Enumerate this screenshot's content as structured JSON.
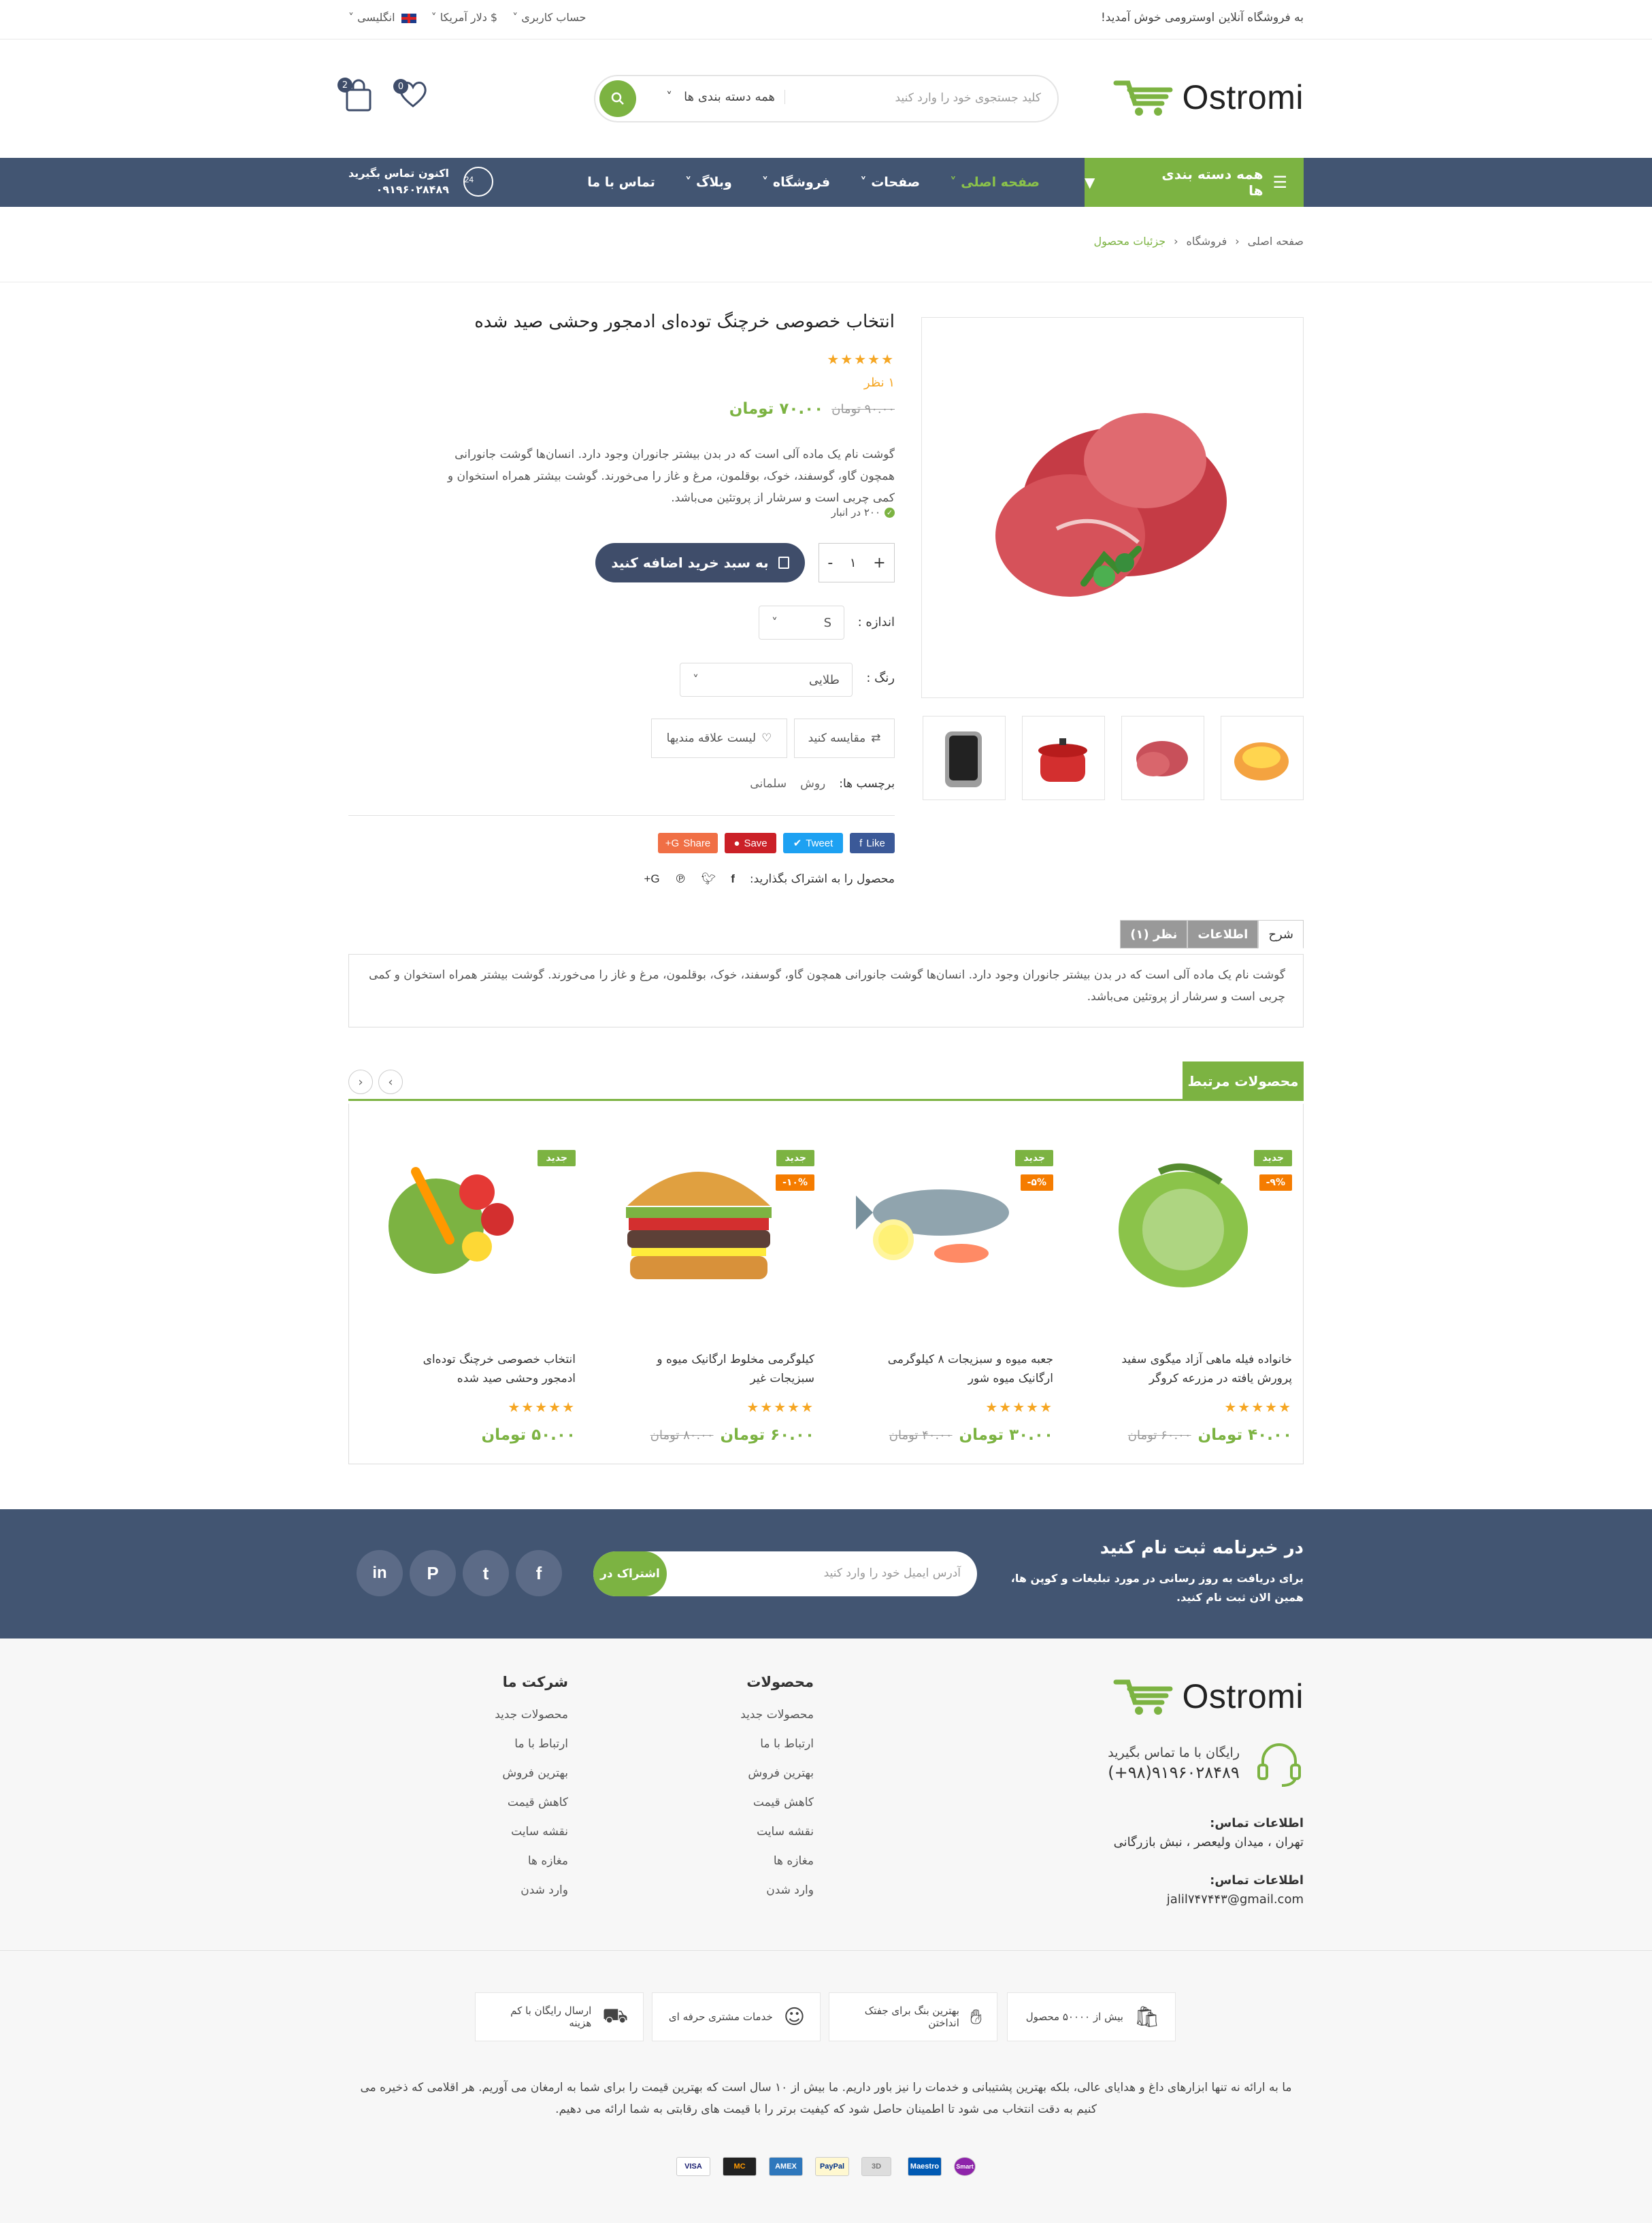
{
  "topbar": {
    "welcome": "به فروشگاه آنلاین اوسترومی خوش آمدید!",
    "account": "حساب کاربری",
    "currency": "$ دلار آمریکا",
    "language": "انگلیسی"
  },
  "brand": {
    "name": "Ostromi",
    "accent": "#7cb342",
    "nav_bg": "#425572"
  },
  "search": {
    "placeholder": "کلید جستجوی خود را وارد کنید",
    "category": "همه دسته بندی ها"
  },
  "header": {
    "wishlist_count": "0",
    "cart_count": "2"
  },
  "nav": {
    "all_categories": "همه دسته بندی ها",
    "items": [
      "صفحه اصلی",
      "صفحات",
      "فروشگاه",
      "وبلاگ",
      "تماس با ما"
    ],
    "call_label": "اکنون تماس بگیرید",
    "call_number": "۰۹۱۹۶۰۲۸۴۸۹",
    "call_badge": "24"
  },
  "breadcrumb": [
    "صفحه اصلی",
    "فروشگاه",
    "جزئیات محصول"
  ],
  "product": {
    "title": "انتخاب خصوصی خرچنگ توده‌ای ادمجور وحشی صید شده",
    "stars": "★★★★★",
    "reviews": "۱ نظر",
    "price_old": "۹۰.۰۰ تومان",
    "price_new": "۷۰.۰۰ تومان",
    "description": "گوشت نام یک ماده آلی است که در بدن بیشتر جانوران وجود دارد. انسان‌ها گوشت جانورانی همچون گاو، گوسفند، خوک، بوقلمون، مرغ و غاز را می‌خورند. گوشت بیشتر همراه استخوان و کمی چربی است و سرشار از پروتئین می‌باشد.",
    "stock": "۲۰۰ در انبار",
    "qty": "۱",
    "add_to_cart": "به سبد خرید اضافه کنید",
    "size_label": "اندازه :",
    "size_value": "S",
    "color_label": "رنگ :",
    "color_value": "طلایی",
    "compare": "مقایسه کنید",
    "wishlist": "لیست علاقه مندیها",
    "tags_label": "برچسب ها:",
    "tags": [
      "روش",
      "سلمانی"
    ],
    "share_buttons": [
      "Like",
      "Tweet",
      "Save",
      "Share"
    ],
    "share_label": "محصول را به اشتراک بگذارید:"
  },
  "tabs": {
    "items": [
      "شرح",
      "اطلاعات",
      "نظر (۱)"
    ],
    "content": "گوشت نام یک ماده آلی است که در بدن بیشتر جانوران وجود دارد. انسان‌ها گوشت جانورانی همچون گاو، گوسفند، خوک، بوقلمون، مرغ و غاز را می‌خورند. گوشت بیشتر همراه استخوان و کمی چربی است و سرشار از پروتئین می‌باشد."
  },
  "related": {
    "title": "محصولات مرتبط",
    "new_label": "جدید",
    "products": [
      {
        "name": "خانواده فیله ماهی آزاد میگوی سفید پرورش یافته در مزرعه کروگر",
        "discount": "-۹%",
        "old": "۶۰.۰۰ تومان",
        "price": "۴۰.۰۰ تومان",
        "stars": "★★★★★"
      },
      {
        "name": "جعبه میوه و سبزیجات ۸ کیلوگرمی ارگانیک میوه شور",
        "discount": "-۵%",
        "old": "۴۰.۰۰ تومان",
        "price": "۳۰.۰۰ تومان",
        "stars": "★★★★★"
      },
      {
        "name": "کیلوگرمی مخلوط ارگانیک میوه و سبزیجات غیر",
        "discount": "-۱۰%",
        "old": "۸۰.۰۰ تومان",
        "price": "۶۰.۰۰ تومان",
        "stars": "★★★★★"
      },
      {
        "name": "انتخاب خصوصی خرچنگ توده‌ای ادمجور وحشی صید شده",
        "discount": "",
        "old": "",
        "price": "۵۰.۰۰ تومان",
        "stars": "★★★★★"
      }
    ]
  },
  "newsletter": {
    "title": "در خبرنامه ثبت نام کنید",
    "text": "برای دریافت به روز رسانی در مورد تبلیغات و کوپن ها، همین الان ثبت نام کنید.",
    "placeholder": "آدرس ایمیل خود را وارد کنید",
    "button": "اشتراک در"
  },
  "footer": {
    "call_free": "رایگان با ما تماس بگیرید",
    "phone": "(+۹۸)۹۱۹۶۰۲۸۴۸۹",
    "address_label": "اطلاعات تماس:",
    "address": "تهران ، میدان ولیعصر ، نبش بازرگانی",
    "email_label": "اطلاعات تماس:",
    "email": "jalil۷۴۷۴۴۳@gmail.com",
    "col1_title": "محصولات",
    "col2_title": "شرکت ما",
    "links": [
      "محصولات جدید",
      "ارتباط با ما",
      "بهترین فروش",
      "کاهش قیمت",
      "نقشه سایت",
      "مغازه ها",
      "وارد شدن"
    ],
    "features": [
      "بیش از ۵۰۰۰۰ محصول",
      "بهترین بنگ برای جفتک انداختن",
      "خدمات مشتری حرفه ای",
      "ارسال رایگان با کم هزینه"
    ],
    "bottom_text": "ما به ارائه نه تنها ابزارهای داغ و هدایای عالی، بلکه بهترین پشتیبانی و خدمات را نیز باور داریم. ما بیش از ۱۰ سال است که بهترین قیمت را برای شما به ارمغان می آوریم. هر اقلامی که ذخیره می کنیم به دقت انتخاب می شود تا اطمینان حاصل شود که کیفیت برتر را با قیمت های رقابتی به شما ارائه می دهیم.",
    "payments": [
      "VISA",
      "MC",
      "AMEX",
      "PayPal",
      "3D",
      "Maestro",
      "Smart"
    ]
  }
}
